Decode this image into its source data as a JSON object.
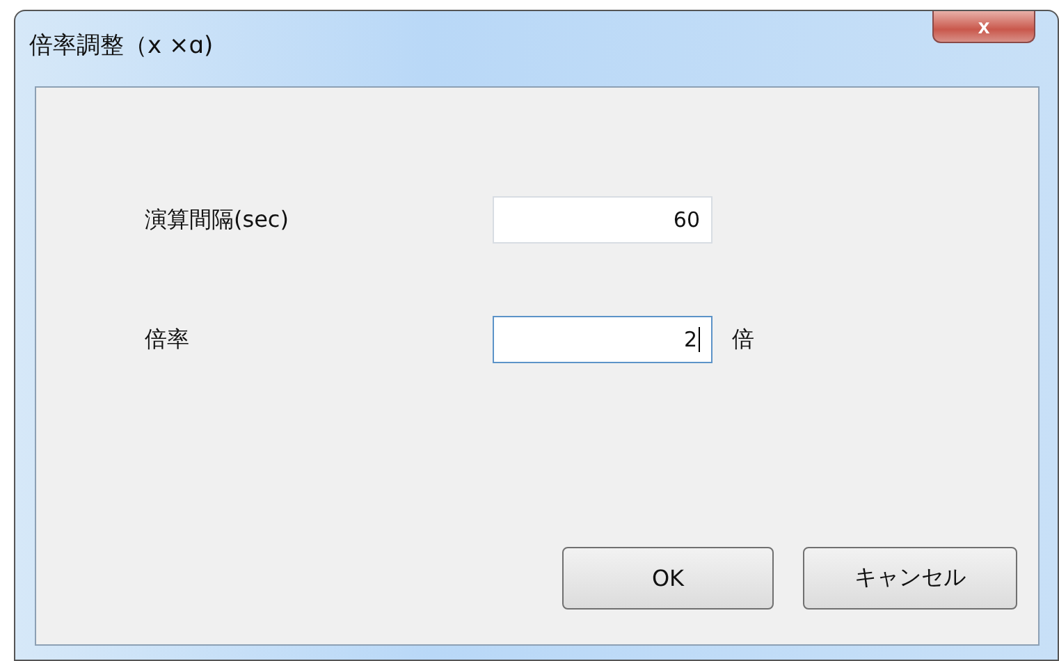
{
  "window": {
    "title": "倍率調整（x ×ɑ)",
    "close": "x"
  },
  "fields": [
    {
      "label": "演算間隔(sec)",
      "value": "60",
      "focused": false
    },
    {
      "label": "倍率",
      "value": "2",
      "unit": "倍",
      "focused": true
    }
  ],
  "buttons": [
    "OK",
    "キャンセル"
  ]
}
